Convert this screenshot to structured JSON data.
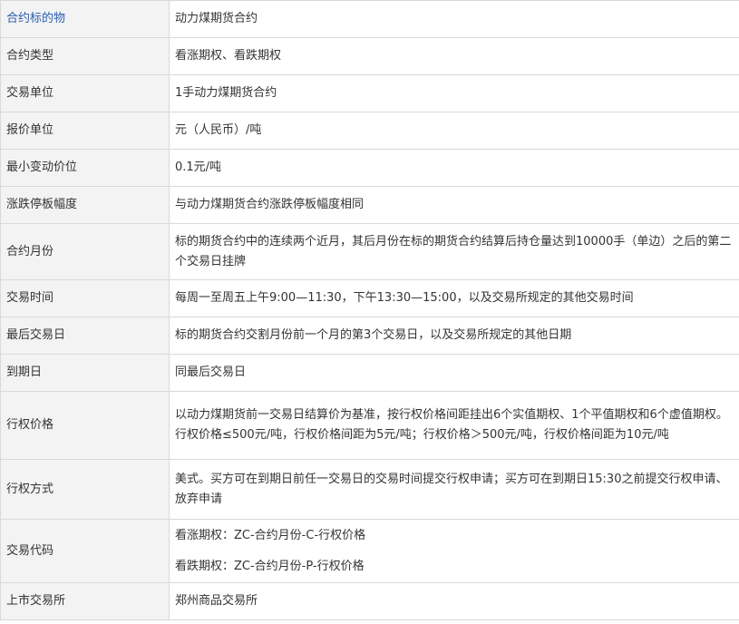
{
  "table": {
    "rows": [
      {
        "label": "合约标的物",
        "value": "动力煤期货合约"
      },
      {
        "label": "合约类型",
        "value": "看涨期权、看跌期权"
      },
      {
        "label": "交易单位",
        "value": "1手动力煤期货合约"
      },
      {
        "label": "报价单位",
        "value": "元（人民币）/吨"
      },
      {
        "label": "最小变动价位",
        "value": "0.1元/吨"
      },
      {
        "label": "涨跌停板幅度",
        "value": "与动力煤期货合约涨跌停板幅度相同"
      },
      {
        "label": "合约月份",
        "value": "标的期货合约中的连续两个近月，其后月份在标的期货合约结算后持仓量达到10000手（单边）之后的第二个交易日挂牌"
      },
      {
        "label": "交易时间",
        "value": "每周一至周五上午9:00—11:30，下午13:30—15:00，以及交易所规定的其他交易时间"
      },
      {
        "label": "最后交易日",
        "value": "标的期货合约交割月份前一个月的第3个交易日，以及交易所规定的其他日期"
      },
      {
        "label": "到期日",
        "value": "同最后交易日"
      },
      {
        "label": "行权价格",
        "value": "以动力煤期货前一交易日结算价为基准，按行权价格间距挂出6个实值期权、1个平值期权和6个虚值期权。行权价格≤500元/吨，行权价格间距为5元/吨；行权价格＞500元/吨，行权价格间距为10元/吨"
      },
      {
        "label": "行权方式",
        "value": "美式。买方可在到期日前任一交易日的交易时间提交行权申请；买方可在到期日15:30之前提交行权申请、放弃申请"
      },
      {
        "label": "交易代码",
        "value_lines": [
          "看涨期权：ZC-合约月份-C-行权价格",
          "看跌期权：ZC-合约月份-P-行权价格"
        ]
      },
      {
        "label": "上市交易所",
        "value": "郑州商品交易所"
      }
    ]
  }
}
